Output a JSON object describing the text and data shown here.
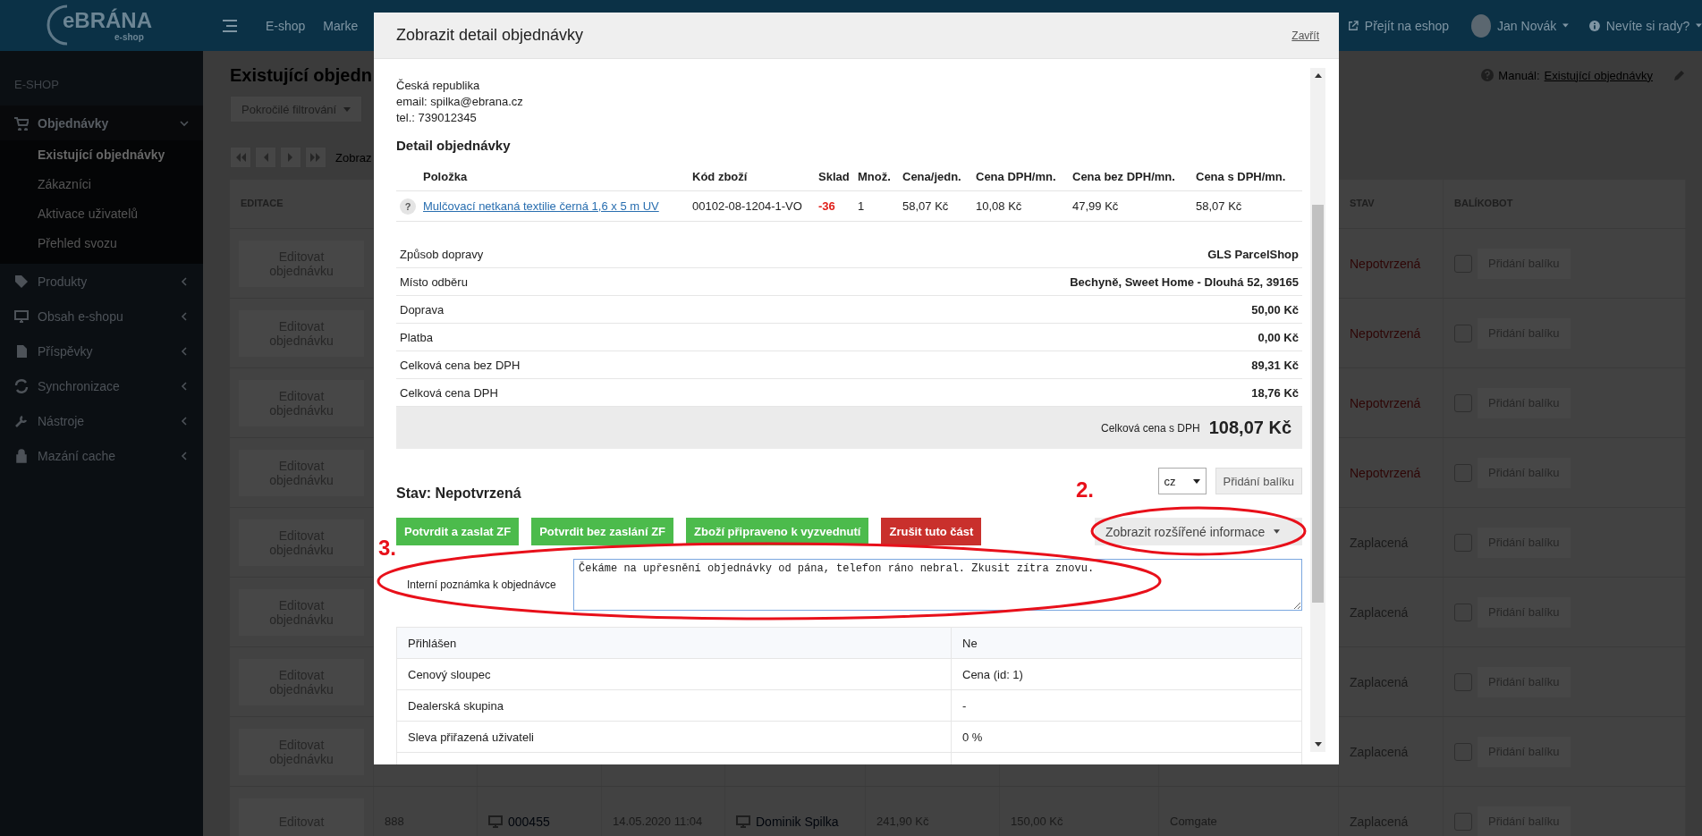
{
  "topbar": {
    "logo": "eBRÁNA",
    "logo_sub": "e-shop",
    "nav": [
      "E-shop",
      "Marke"
    ],
    "eshop_link": "Přejít na eshop",
    "user": "Jan Novák",
    "help": "Nevíte si rady?"
  },
  "sidebar": {
    "section": "E-SHOP",
    "items": [
      {
        "label": "Objednávky",
        "expanded": true,
        "children": [
          {
            "label": "Existující objednávky",
            "selected": true
          },
          {
            "label": "Zákazníci",
            "selected": false
          },
          {
            "label": "Aktivace uživatelů",
            "selected": false
          },
          {
            "label": "Přehled svozu",
            "selected": false
          }
        ]
      },
      {
        "label": "Produkty",
        "expanded": false
      },
      {
        "label": "Obsah e-shopu",
        "expanded": false
      },
      {
        "label": "Příspěvky",
        "expanded": false
      },
      {
        "label": "Synchronizace",
        "expanded": false
      },
      {
        "label": "Nástroje",
        "expanded": false
      },
      {
        "label": "Mazání cache",
        "expanded": false
      }
    ]
  },
  "page": {
    "title": "Existující objedn",
    "filter_button": "Pokročilé filtrování",
    "manual_label": "Manuál:",
    "manual_link": "Existující objednávky",
    "pager_text": "Zobraz"
  },
  "table": {
    "columns": [
      "EDITACE",
      "STAV",
      "BALÍKOBOT"
    ],
    "rows": [
      {
        "edit": "Editovat objednávku",
        "status": "Nepotvrzená",
        "unconfirmed": true,
        "checked": false,
        "package": "Přidání balíku"
      },
      {
        "edit": "Editovat objednávku",
        "status": "Nepotvrzená",
        "unconfirmed": true,
        "checked": false,
        "package": "Přidání balíku"
      },
      {
        "edit": "Editovat objednávku",
        "status": "Nepotvrzená",
        "unconfirmed": true,
        "checked": false,
        "package": "Přidání balíku"
      },
      {
        "edit": "Editovat objednávku",
        "status": "Nepotvrzená",
        "unconfirmed": true,
        "checked": false,
        "package": "Přidání balíku"
      },
      {
        "edit": "Editovat objednávku",
        "status": "Zaplacená",
        "unconfirmed": false,
        "checked": false,
        "package": "Přidání balíku"
      },
      {
        "edit": "Editovat objednávku",
        "status": "Zaplacená",
        "unconfirmed": false,
        "checked": false,
        "package": "Přidání balíku"
      },
      {
        "edit": "Editovat objednávku",
        "status": "Zaplacená",
        "unconfirmed": false,
        "checked": false,
        "package": "Přidání balíku"
      },
      {
        "edit": "Editovat objednávku",
        "status": "Zaplacená",
        "unconfirmed": false,
        "checked": false,
        "package": "Přidání balíku"
      },
      {
        "edit": "Editovat",
        "number": "888",
        "order": "000455",
        "date": "14.05.2020 11:04",
        "customer": "Dominik Spilka",
        "total": "241,90 Kč",
        "shipping": "150,00 Kč",
        "payment": "Comgate",
        "status": "Zaplacená",
        "unconfirmed": false,
        "checked": false,
        "package": "Přidání balíku"
      }
    ]
  },
  "dialog": {
    "title": "Zobrazit detail objednávky",
    "close": "Zavřít",
    "address": [
      "Česká republika",
      "email: spilka@ebrana.cz",
      "tel.: 739012345"
    ],
    "detail_heading": "Detail objednávky",
    "items_columns": [
      "Položka",
      "Kód zboží",
      "Sklad",
      "Množ.",
      "Cena/jedn.",
      "Cena DPH/mn.",
      "Cena bez DPH/mn.",
      "Cena s DPH/mn."
    ],
    "items": [
      {
        "help": "?",
        "name": "Mulčovací netkaná textilie černá 1,6 x 5 m UV",
        "code": "00102-08-1204-1-VO",
        "stock": "-36",
        "stock_alert": true,
        "qty": "1",
        "unit_price": "58,07 Kč",
        "vat": "10,08 Kč",
        "net": "47,99 Kč",
        "gross": "58,07 Kč"
      }
    ],
    "summary": [
      {
        "label": "Způsob dopravy",
        "value": "GLS ParcelShop"
      },
      {
        "label": "Místo odběru",
        "value": "Bechyně, Sweet Home - Dlouhá 52, 39165"
      },
      {
        "label": "Doprava",
        "value": "50,00 Kč"
      },
      {
        "label": "Platba",
        "value": "0,00 Kč"
      },
      {
        "label": "Celková cena bez DPH",
        "value": "89,31 Kč"
      },
      {
        "label": "Celková cena DPH",
        "value": "18,76 Kč"
      }
    ],
    "total": {
      "label": "Celková cena s DPH",
      "value": "108,07 Kč"
    },
    "status": "Stav: Nepotvrzená",
    "language": "cz",
    "package_button": "Přidání balíku",
    "actions": [
      {
        "label": "Potvrdit a zaslat ZF",
        "kind": "success"
      },
      {
        "label": "Potvrdit bez zaslání ZF",
        "kind": "success"
      },
      {
        "label": "Zboží připraveno k vyzvednutí",
        "kind": "success"
      },
      {
        "label": "Zrušit tuto část",
        "kind": "danger"
      }
    ],
    "more_button": "Zobrazit rozšířené informace",
    "note": {
      "label": "Interní poznámka k objednávce",
      "value": "Čekáme na upřesnění objednávky od pána, telefon ráno nebral. Zkusit zítra znovu."
    },
    "info": [
      {
        "label": "Přihlášen",
        "value": "Ne"
      },
      {
        "label": "Cenový sloupec",
        "value": "Cena (id: 1)"
      },
      {
        "label": "Dealerská skupina",
        "value": "-"
      },
      {
        "label": "Sleva přiřazená uživateli",
        "value": "0 %"
      }
    ]
  },
  "annotations": [
    {
      "label": "2."
    },
    {
      "label": "3."
    }
  ]
}
